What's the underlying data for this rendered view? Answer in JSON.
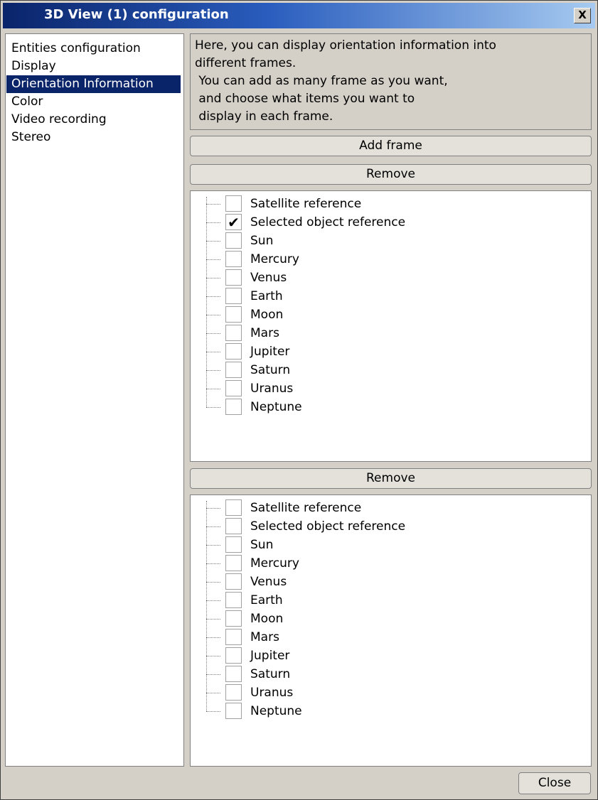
{
  "window": {
    "title": "3D View (1) configuration",
    "close_glyph": "X"
  },
  "sidebar": {
    "items": [
      {
        "label": "Entities configuration",
        "selected": false
      },
      {
        "label": "Display",
        "selected": false
      },
      {
        "label": "Orientation Information",
        "selected": true
      },
      {
        "label": "Color",
        "selected": false
      },
      {
        "label": "Video recording",
        "selected": false
      },
      {
        "label": "Stereo",
        "selected": false
      }
    ]
  },
  "info": {
    "lines": [
      "Here, you can display orientation information into",
      "different frames.",
      " You can add as many frame as you want,",
      " and choose what items you want to",
      " display in each frame."
    ]
  },
  "buttons": {
    "add_frame": "Add frame",
    "remove": "Remove",
    "close": "Close"
  },
  "frames": [
    {
      "items": [
        {
          "label": "Satellite reference",
          "checked": false
        },
        {
          "label": "Selected object reference",
          "checked": true
        },
        {
          "label": "Sun",
          "checked": false
        },
        {
          "label": "Mercury",
          "checked": false
        },
        {
          "label": "Venus",
          "checked": false
        },
        {
          "label": "Earth",
          "checked": false
        },
        {
          "label": "Moon",
          "checked": false
        },
        {
          "label": "Mars",
          "checked": false
        },
        {
          "label": "Jupiter",
          "checked": false
        },
        {
          "label": "Saturn",
          "checked": false
        },
        {
          "label": "Uranus",
          "checked": false
        },
        {
          "label": "Neptune",
          "checked": false
        }
      ]
    },
    {
      "items": [
        {
          "label": "Satellite reference",
          "checked": false
        },
        {
          "label": "Selected object reference",
          "checked": false
        },
        {
          "label": "Sun",
          "checked": false
        },
        {
          "label": "Mercury",
          "checked": false
        },
        {
          "label": "Venus",
          "checked": false
        },
        {
          "label": "Earth",
          "checked": false
        },
        {
          "label": "Moon",
          "checked": false
        },
        {
          "label": "Mars",
          "checked": false
        },
        {
          "label": "Jupiter",
          "checked": false
        },
        {
          "label": "Saturn",
          "checked": false
        },
        {
          "label": "Uranus",
          "checked": false
        },
        {
          "label": "Neptune",
          "checked": false
        }
      ]
    }
  ],
  "icons": {
    "check": "checkmark-icon"
  }
}
